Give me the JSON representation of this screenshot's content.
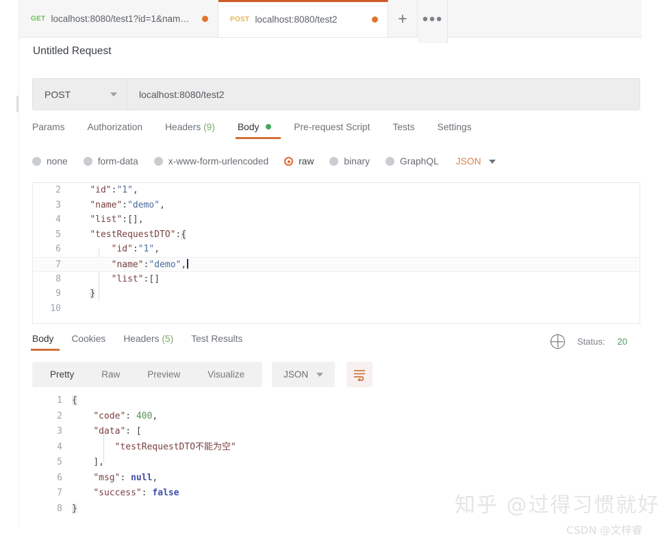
{
  "tabs": [
    {
      "verb": "GET",
      "url": "localhost:8080/test1?id=1&nam…",
      "unsaved": true,
      "active": false
    },
    {
      "verb": "POST",
      "url": "localhost:8080/test2",
      "unsaved": true,
      "active": true
    }
  ],
  "tabbar": {
    "new_tab_label": "+",
    "more_label": "●●●"
  },
  "request": {
    "title": "Untitled Request",
    "method": "POST",
    "url": "localhost:8080/test2",
    "tabs": [
      {
        "label": "Params",
        "count": "",
        "selected": false
      },
      {
        "label": "Authorization",
        "count": "",
        "selected": false
      },
      {
        "label": "Headers",
        "count": "(9)",
        "selected": false
      },
      {
        "label": "Body",
        "count": "",
        "selected": true
      },
      {
        "label": "Pre-request Script",
        "count": "",
        "selected": false
      },
      {
        "label": "Tests",
        "count": "",
        "selected": false
      },
      {
        "label": "Settings",
        "count": "",
        "selected": false
      }
    ],
    "body_types": [
      {
        "label": "none",
        "selected": false
      },
      {
        "label": "form-data",
        "selected": false
      },
      {
        "label": "x-www-form-urlencoded",
        "selected": false
      },
      {
        "label": "raw",
        "selected": true
      },
      {
        "label": "binary",
        "selected": false
      },
      {
        "label": "GraphQL",
        "selected": false
      }
    ],
    "format": "JSON",
    "code_lines": [
      {
        "num": "2",
        "text": "    \"id\":\"1\","
      },
      {
        "num": "3",
        "text": "    \"name\":\"demo\","
      },
      {
        "num": "4",
        "text": "    \"list\":[],"
      },
      {
        "num": "5",
        "text": "    \"testRequestDTO\":{"
      },
      {
        "num": "6",
        "text": "        \"id\":\"1\","
      },
      {
        "num": "7",
        "text": "        \"name\":\"demo\","
      },
      {
        "num": "8",
        "text": "        \"list\":[]"
      },
      {
        "num": "9",
        "text": "    }"
      },
      {
        "num": "10",
        "text": ""
      }
    ],
    "active_line": "7"
  },
  "response": {
    "tabs": [
      {
        "label": "Body",
        "count": "",
        "selected": true
      },
      {
        "label": "Cookies",
        "count": "",
        "selected": false
      },
      {
        "label": "Headers",
        "count": "(5)",
        "selected": false
      },
      {
        "label": "Test Results",
        "count": "",
        "selected": false
      }
    ],
    "status_label": "Status:",
    "status_value": "20",
    "view_modes": [
      {
        "label": "Pretty",
        "selected": true
      },
      {
        "label": "Raw",
        "selected": false
      },
      {
        "label": "Preview",
        "selected": false
      },
      {
        "label": "Visualize",
        "selected": false
      }
    ],
    "format": "JSON",
    "code_lines": [
      {
        "num": "1",
        "text": "{"
      },
      {
        "num": "2",
        "text": "    \"code\": 400,"
      },
      {
        "num": "3",
        "text": "    \"data\": ["
      },
      {
        "num": "4",
        "text": "        \"testRequestDTO不能为空\""
      },
      {
        "num": "5",
        "text": "    ],"
      },
      {
        "num": "6",
        "text": "    \"msg\": null,"
      },
      {
        "num": "7",
        "text": "    \"success\": false"
      },
      {
        "num": "8",
        "text": "}"
      }
    ]
  },
  "watermarks": {
    "zhihu": "知乎 @过得习惯就好",
    "csdn": "CSDN @文梓睿"
  },
  "colors": {
    "accent": "#d1703a",
    "get": "#6bbf59",
    "post": "#e5b84b",
    "success_dot": "#41a85f",
    "unsaved_dot": "#e1742c",
    "status": "#4d9b58"
  }
}
